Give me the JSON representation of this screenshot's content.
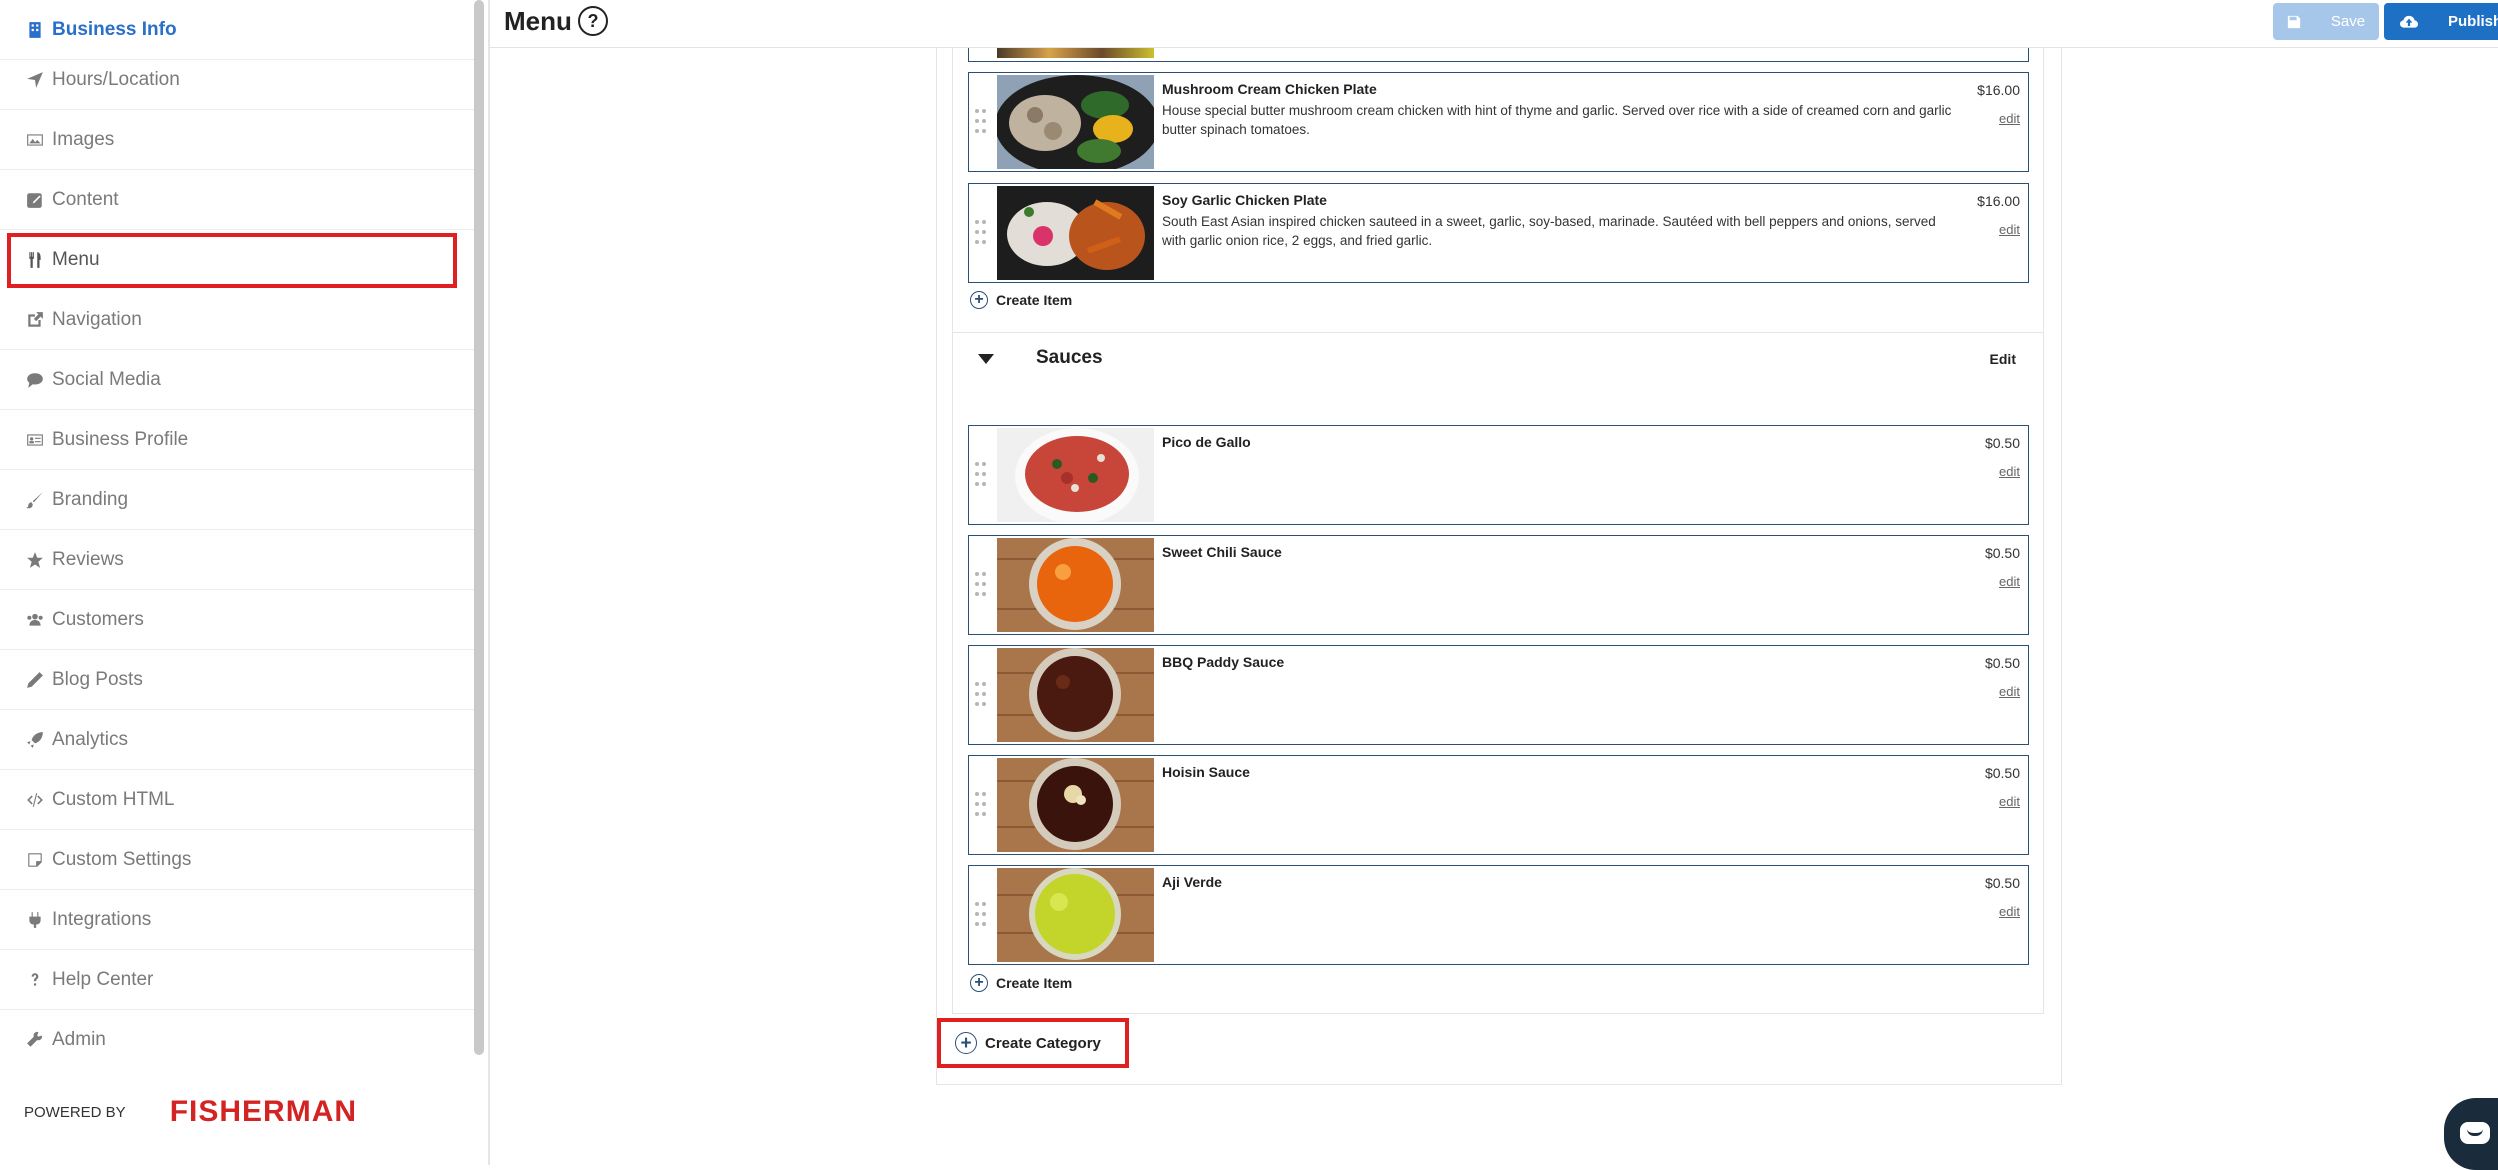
{
  "sidebar": {
    "items": [
      {
        "label": "Business Info",
        "icon": "building-icon"
      },
      {
        "label": "Hours/Location",
        "icon": "location-arrow-icon"
      },
      {
        "label": "Images",
        "icon": "image-icon"
      },
      {
        "label": "Content",
        "icon": "edit-square-icon"
      },
      {
        "label": "Menu",
        "icon": "utensils-icon"
      },
      {
        "label": "Navigation",
        "icon": "external-link-icon"
      },
      {
        "label": "Social Media",
        "icon": "chat-icon"
      },
      {
        "label": "Business Profile",
        "icon": "id-card-icon"
      },
      {
        "label": "Branding",
        "icon": "paintbrush-icon"
      },
      {
        "label": "Reviews",
        "icon": "star-icon"
      },
      {
        "label": "Customers",
        "icon": "users-icon"
      },
      {
        "label": "Blog Posts",
        "icon": "pencil-icon"
      },
      {
        "label": "Analytics",
        "icon": "rocket-icon"
      },
      {
        "label": "Custom HTML",
        "icon": "code-icon"
      },
      {
        "label": "Custom Settings",
        "icon": "note-icon"
      },
      {
        "label": "Integrations",
        "icon": "plug-icon"
      },
      {
        "label": "Help Center",
        "icon": "question-icon"
      },
      {
        "label": "Admin",
        "icon": "wrench-icon"
      }
    ],
    "powered_by": "POWERED BY",
    "brand": "FISHERMAN"
  },
  "header": {
    "title": "Menu",
    "help": "?",
    "save_label": "Save",
    "publish_label": "Publish"
  },
  "items_top": [
    {
      "name": "Mushroom Cream Chicken Plate",
      "desc": "House special butter mushroom cream chicken with hint of thyme and garlic. Served over rice with a side of creamed corn and garlic butter spinach tomatoes.",
      "price": "$16.00",
      "edit": "edit"
    },
    {
      "name": "Soy Garlic Chicken Plate",
      "desc": "South East Asian inspired chicken sauteed in a sweet, garlic, soy-based, marinade. Sautéed with bell peppers and onions, served with garlic onion rice, 2 eggs, and fried garlic.",
      "price": "$16.00",
      "edit": "edit"
    }
  ],
  "create_item_label": "Create Item",
  "sauces": {
    "title": "Sauces",
    "edit": "Edit",
    "items": [
      {
        "name": "Pico de Gallo",
        "price": "$0.50",
        "edit": "edit"
      },
      {
        "name": "Sweet Chili Sauce",
        "price": "$0.50",
        "edit": "edit"
      },
      {
        "name": "BBQ Paddy Sauce",
        "price": "$0.50",
        "edit": "edit"
      },
      {
        "name": "Hoisin Sauce",
        "price": "$0.50",
        "edit": "edit"
      },
      {
        "name": "Aji Verde",
        "price": "$0.50",
        "edit": "edit"
      }
    ]
  },
  "create_category_label": "Create Category",
  "colors": {
    "accent": "#1e70c4",
    "highlight": "#e02020",
    "card_border": "#2c4f78",
    "brand": "#d42323"
  }
}
